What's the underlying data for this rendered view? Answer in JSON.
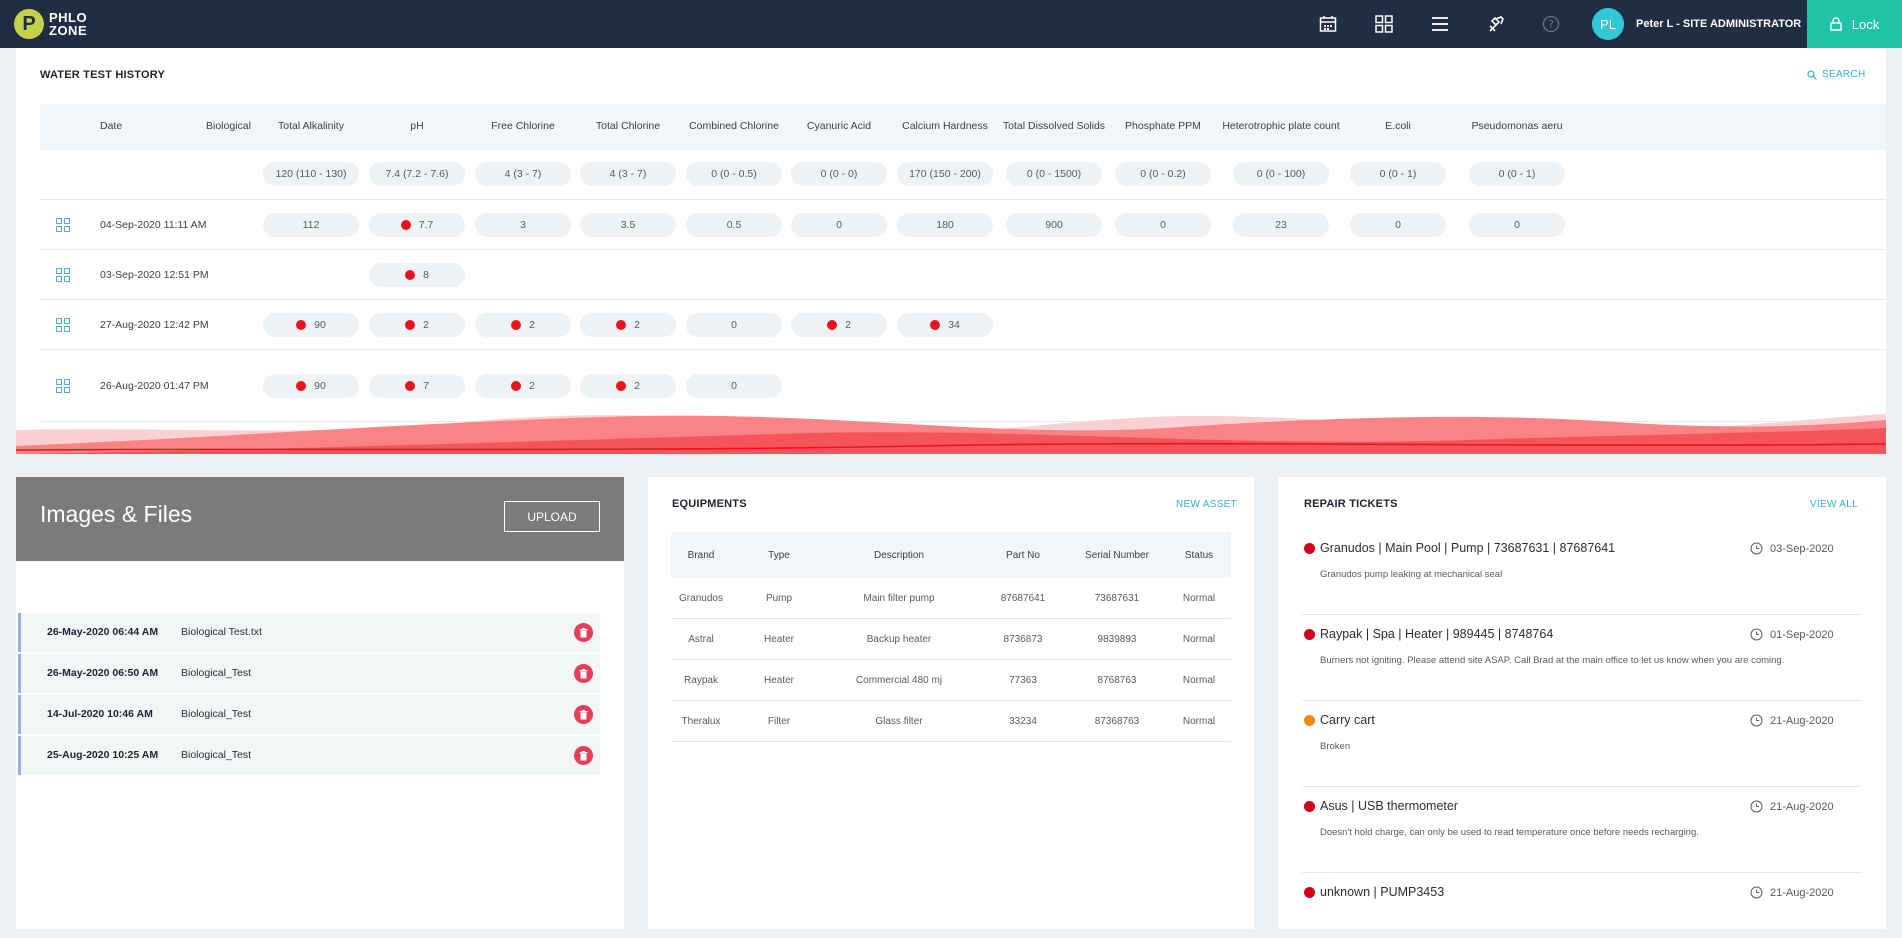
{
  "app": {
    "logo_letter": "P",
    "logo_line1": "PHLO",
    "logo_line2": "ZONE"
  },
  "topbar": {
    "icons": [
      "calendar-icon",
      "grid-icon",
      "menu-icon",
      "tools-icon",
      "help-icon"
    ],
    "avatar_initials": "PL",
    "user_label": "Peter L - SITE ADMINISTRATOR",
    "lock_label": "Lock"
  },
  "water_test": {
    "title": "WATER TEST HISTORY",
    "search_label": "SEARCH",
    "columns": [
      "Date",
      "Biological",
      "Total Alkalinity",
      "pH",
      "Free Chlorine",
      "Total Chlorine",
      "Combined Chlorine",
      "Cyanuric Acid",
      "Calcium Hardness",
      "Total Dissolved Solids",
      "Phosphate PPM",
      "Heterotrophic plate count",
      "E.coli",
      "Pseudomonas aeru"
    ],
    "ranges": [
      "120 (110 - 130)",
      "7.4 (7.2 - 7.6)",
      "4 (3 - 7)",
      "4 (3 - 7)",
      "0 (0 - 0.5)",
      "0 (0 - 0)",
      "170 (150 - 200)",
      "0 (0 - 1500)",
      "0 (0 - 0.2)",
      "0 (0 - 100)",
      "0 (0 - 1)",
      "0 (0 - 1)"
    ],
    "rows": [
      {
        "date": "04-Sep-2020 11:11 AM",
        "cells": [
          {
            "v": "112",
            "alert": false
          },
          {
            "v": "7.7",
            "alert": true
          },
          {
            "v": "3",
            "alert": false
          },
          {
            "v": "3.5",
            "alert": false
          },
          {
            "v": "0.5",
            "alert": false
          },
          {
            "v": "0",
            "alert": false
          },
          {
            "v": "180",
            "alert": false
          },
          {
            "v": "900",
            "alert": false
          },
          {
            "v": "0",
            "alert": false
          },
          {
            "v": "23",
            "alert": false
          },
          {
            "v": "0",
            "alert": false
          },
          {
            "v": "0",
            "alert": false
          }
        ]
      },
      {
        "date": "03-Sep-2020 12:51 PM",
        "cells": [
          null,
          {
            "v": "8",
            "alert": true
          },
          null,
          null,
          null,
          null,
          null,
          null,
          null,
          null,
          null,
          null
        ]
      },
      {
        "date": "27-Aug-2020 12:42 PM",
        "cells": [
          {
            "v": "90",
            "alert": true
          },
          {
            "v": "2",
            "alert": true
          },
          {
            "v": "2",
            "alert": true
          },
          {
            "v": "2",
            "alert": true
          },
          {
            "v": "0",
            "alert": false
          },
          {
            "v": "2",
            "alert": true
          },
          {
            "v": "34",
            "alert": true
          },
          null,
          null,
          null,
          null,
          null
        ]
      },
      {
        "date": "26-Aug-2020 01:47 PM",
        "cells": [
          {
            "v": "90",
            "alert": true
          },
          {
            "v": "7",
            "alert": true
          },
          {
            "v": "2",
            "alert": true
          },
          {
            "v": "2",
            "alert": true
          },
          {
            "v": "0",
            "alert": false
          },
          null,
          null,
          null,
          null,
          null,
          null,
          null
        ]
      }
    ]
  },
  "images_files": {
    "title": "Images & Files",
    "upload_label": "UPLOAD",
    "files": [
      {
        "date": "26-May-2020 06:44 AM",
        "name": "Biological Test.txt"
      },
      {
        "date": "26-May-2020 06:50 AM",
        "name": "Biological_Test"
      },
      {
        "date": "14-Jul-2020 10:46 AM",
        "name": "Biological_Test"
      },
      {
        "date": "25-Aug-2020 10:25 AM",
        "name": "Biological_Test"
      }
    ]
  },
  "equipments": {
    "title": "EQUIPMENTS",
    "new_asset_label": "NEW ASSET",
    "columns": [
      "Brand",
      "Type",
      "Description",
      "Part No",
      "Serial Number",
      "Status"
    ],
    "rows": [
      [
        "Granudos",
        "Pump",
        "Main filter pump",
        "87687641",
        "73687631",
        "Normal"
      ],
      [
        "Astral",
        "Heater",
        "Backup heater",
        "8736873",
        "9839893",
        "Normal"
      ],
      [
        "Raypak",
        "Heater",
        "Commercial 480 mj",
        "77363",
        "8768763",
        "Normal"
      ],
      [
        "Theralux",
        "Filter",
        "Glass filter",
        "33234",
        "87368763",
        "Normal"
      ]
    ]
  },
  "repair_tickets": {
    "title": "REPAIR TICKETS",
    "view_all_label": "VIEW ALL",
    "tickets": [
      {
        "title": "Granudos | Main Pool | Pump | 73687631 | 87687641",
        "desc": "Granudos pump leaking at mechanical seal",
        "date": "03-Sep-2020",
        "color": "#d0021b"
      },
      {
        "title": "Raypak | Spa | Heater | 989445 | 8748764",
        "desc": "Burners not igniting. Please attend site ASAP. Call Brad at the main office to let us know when you are coming.",
        "date": "01-Sep-2020",
        "color": "#d0021b"
      },
      {
        "title": "Carry cart",
        "desc": "Broken",
        "date": "21-Aug-2020",
        "color": "#f08a14"
      },
      {
        "title": "Asus | USB thermometer",
        "desc": "Doesn't hold charge, can only be used to read temperature once before needs recharging.",
        "date": "21-Aug-2020",
        "color": "#d0021b"
      },
      {
        "title": "unknown | PUMP3453",
        "desc": "",
        "date": "21-Aug-2020",
        "color": "#d0021b"
      }
    ]
  }
}
